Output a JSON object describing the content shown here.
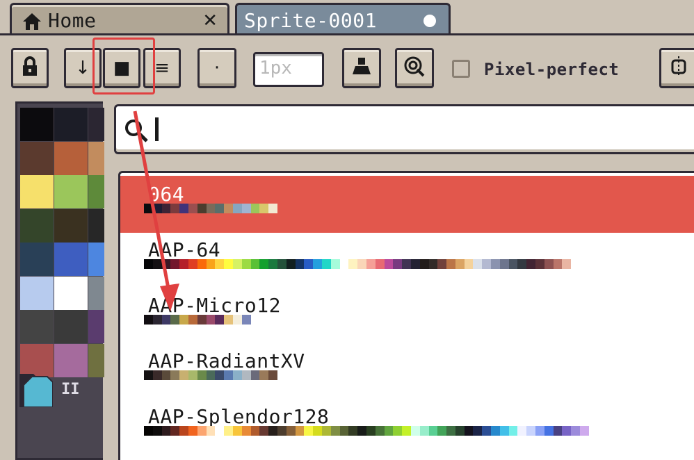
{
  "tabs": [
    {
      "label": "Home",
      "close_icon": "close-icon"
    },
    {
      "label": "Sprite-0001",
      "modified_icon": "unsaved-dot-icon"
    }
  ],
  "toolbar": {
    "buttons": [
      {
        "icon": "lock-icon",
        "glyph": "🔒"
      },
      {
        "icon": "arrow-down-icon",
        "glyph": "↓"
      },
      {
        "icon": "square-brush-icon",
        "glyph": "■"
      },
      {
        "icon": "menu-lines-icon",
        "glyph": "≡"
      },
      {
        "icon": "dot-brush-icon",
        "glyph": "·"
      }
    ],
    "size_field": {
      "value": "1",
      "placeholder": "1px"
    },
    "ink_icon": "ink-icon",
    "pressure_icon": "pressure-icon",
    "pixel_perfect": {
      "label": "Pixel-perfect",
      "checked": false
    },
    "symmetry_icon": "symmetry-icon"
  },
  "sidebar": {
    "swatches": [
      [
        "#0c0b0e",
        "#1c1d27",
        "#2b2632"
      ],
      [
        "#5b3a2e",
        "#b6603a",
        "#c28c5e"
      ],
      [
        "#f6e06b",
        "#9bc65b",
        "#5e8a3a"
      ],
      [
        "#34452a",
        "#3a3120",
        "#272727"
      ],
      [
        "#294057",
        "#3e5ec0",
        "#4d86e0"
      ],
      [
        "#b7cbee",
        "#ffffff",
        "#7f8890"
      ],
      [
        "#444444",
        "#3a3a3a",
        "#5a3c6e"
      ],
      [
        "#a84f4f",
        "#a56b9d",
        "#6f7040"
      ]
    ],
    "fg_color": "#56b8d2",
    "pause_label": "II"
  },
  "search": {
    "value": "",
    "placeholder": ""
  },
  "palettes": [
    {
      "name": "064",
      "selected": true,
      "colors": [
        "#0c0b0e",
        "#1d1c34",
        "#3d2435",
        "#7a3b3d",
        "#41337a",
        "#9a4f4f",
        "#4a3d2e",
        "#7a6b5a",
        "#5a6e6a",
        "#c28c5e",
        "#86a6c0",
        "#a0b4d0",
        "#9bc65b",
        "#d8c86b",
        "#f2e9d2"
      ]
    },
    {
      "name": "AAP-64",
      "selected": false,
      "colors": [
        "#060608",
        "#141013",
        "#3b1725",
        "#73172d",
        "#b4202a",
        "#df3e23",
        "#fa6a0a",
        "#f9a31b",
        "#ffd541",
        "#fffc40",
        "#d6f264",
        "#9cdb43",
        "#59c135",
        "#14a02e",
        "#1a7a3e",
        "#24523b",
        "#122020",
        "#143464",
        "#285cc4",
        "#249fde",
        "#20d6c7",
        "#a6fcdb",
        "#ffffff",
        "#fef3c0",
        "#fad6b8",
        "#f5a097",
        "#e86a73",
        "#bc4a9b",
        "#793a80",
        "#403353",
        "#242234",
        "#221c1a",
        "#322b28",
        "#71413b",
        "#bb7547",
        "#dba463",
        "#f4d29c",
        "#dae0ea",
        "#b3b9d1",
        "#8b93af",
        "#6d758d",
        "#4a5462",
        "#333941",
        "#422433",
        "#5b3138",
        "#8e5252",
        "#ba756a",
        "#e9b5a3"
      ]
    },
    {
      "name": "AAP-Micro12",
      "selected": false,
      "colors": [
        "#120e12",
        "#2b2632",
        "#3e3a66",
        "#5a6b4a",
        "#c8a84a",
        "#b86a3a",
        "#6a3b3a",
        "#9a4a6a",
        "#5a2a5a",
        "#e6c27a",
        "#f4eedc",
        "#7a86b8"
      ]
    },
    {
      "name": "AAP-RadiantXV",
      "selected": false,
      "colors": [
        "#151213",
        "#3a2a2a",
        "#5a4a3a",
        "#8a7a5a",
        "#c8b070",
        "#a8b86a",
        "#6a8a4a",
        "#4a6a5a",
        "#3a4a6a",
        "#5a7ab0",
        "#8ab0c8",
        "#b0b8c0",
        "#6a6a7a",
        "#9a7a5a",
        "#6a4a3a"
      ]
    },
    {
      "name": "AAP-Splendor128",
      "selected": false,
      "colors": [
        "#050403",
        "#0e0c0c",
        "#2d1b1e",
        "#612721",
        "#b9451d",
        "#f1641f",
        "#fca570",
        "#ffe0b7",
        "#ffffff",
        "#fff089",
        "#f8c53a",
        "#e88a36",
        "#b05b2c",
        "#673931",
        "#271f1b",
        "#4c3d2e",
        "#855f39",
        "#d39741",
        "#f8f644",
        "#d5dc1d",
        "#adb834",
        "#7f8e44",
        "#586335",
        "#333c24",
        "#181c19",
        "#293f21",
        "#477238",
        "#61a53f",
        "#8fd032",
        "#c4f129",
        "#d0ffea",
        "#97edca",
        "#59cf93",
        "#42a459",
        "#3d6f43",
        "#27412d",
        "#14121d",
        "#1b2447",
        "#2b4e95",
        "#2789cd",
        "#42bfe8",
        "#73efe8",
        "#f1f2ff",
        "#c9d4fd",
        "#8aa1f6",
        "#4572e3",
        "#494182",
        "#7864c6",
        "#9c8bdb",
        "#ceaaed"
      ]
    }
  ]
}
